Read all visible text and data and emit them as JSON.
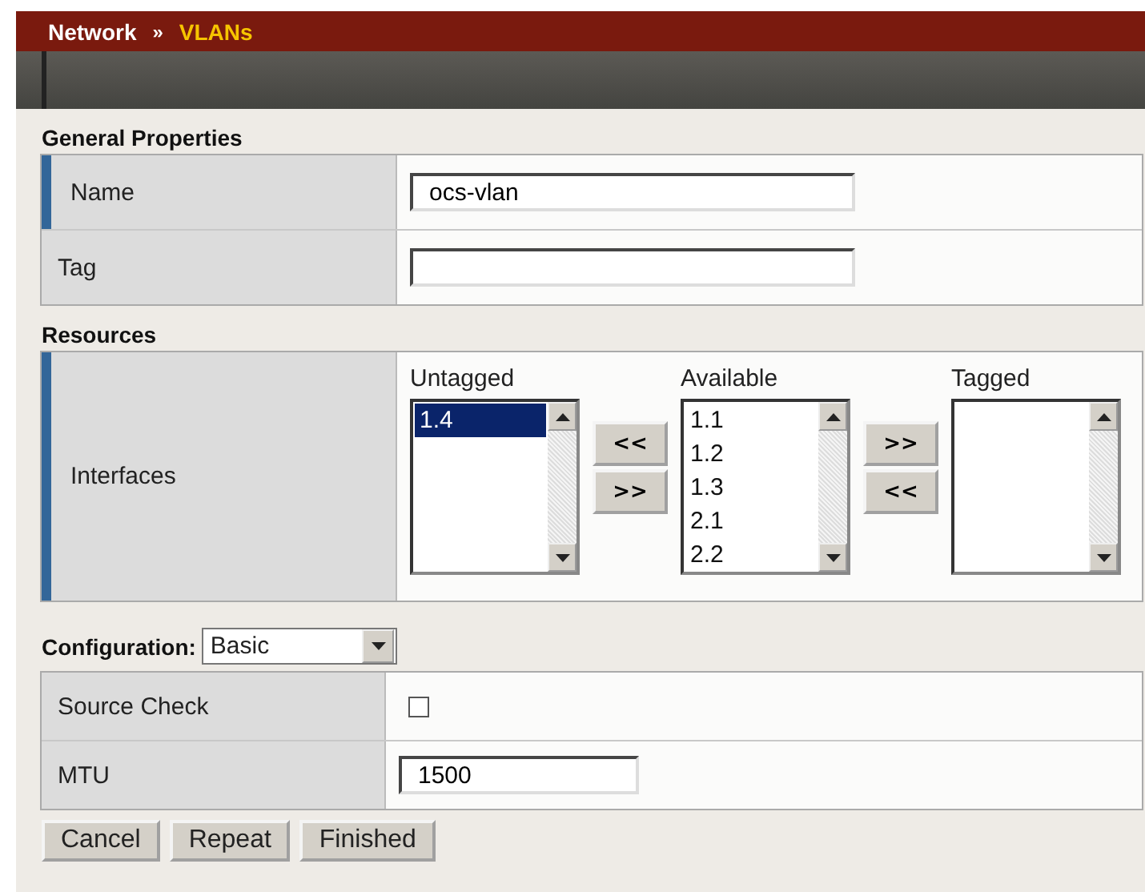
{
  "breadcrumb": {
    "section": "Network",
    "separator": "»",
    "page": "VLANs"
  },
  "general": {
    "title": "General Properties",
    "rows": [
      {
        "label": "Name",
        "required": true,
        "value": "ocs-vlan"
      },
      {
        "label": "Tag",
        "required": false,
        "value": ""
      }
    ]
  },
  "resources": {
    "title": "Resources",
    "label": "Interfaces",
    "required": true,
    "lists": [
      {
        "title": "Untagged",
        "items": [
          {
            "label": "1.4",
            "selected": true
          }
        ]
      },
      {
        "title": "Available",
        "items": [
          {
            "label": "1.1",
            "selected": false
          },
          {
            "label": "1.2",
            "selected": false
          },
          {
            "label": "1.3",
            "selected": false
          },
          {
            "label": "2.1",
            "selected": false
          },
          {
            "label": "2.2",
            "selected": false
          }
        ]
      },
      {
        "title": "Tagged"
      }
    ],
    "move_buttons": [
      [
        "<<",
        ">>"
      ],
      [
        ">>",
        "<<"
      ]
    ]
  },
  "configuration": {
    "label": "Configuration:",
    "value": "Basic",
    "rows": [
      {
        "kind": "checkbox",
        "label": "Source Check",
        "checked": false
      },
      {
        "kind": "text",
        "label": "MTU",
        "value": "1500"
      }
    ]
  },
  "buttons": [
    "Cancel",
    "Repeat",
    "Finished"
  ]
}
